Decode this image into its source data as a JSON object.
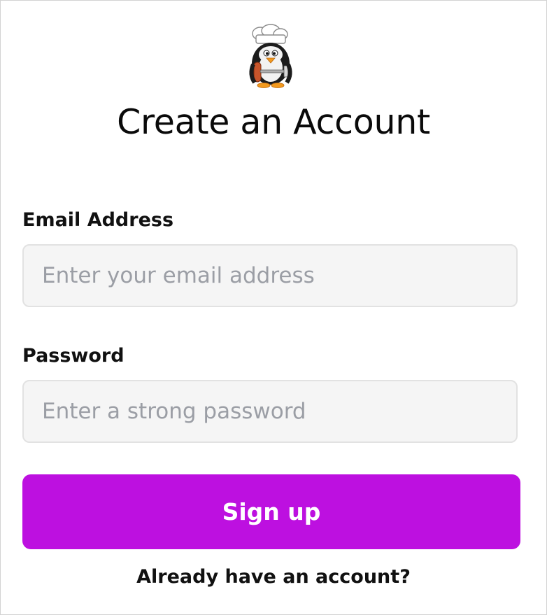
{
  "logo": {
    "icon": "penguin-chef-icon"
  },
  "title": "Create an Account",
  "email": {
    "label": "Email Address",
    "placeholder": "Enter your email address",
    "value": ""
  },
  "password": {
    "label": "Password",
    "placeholder": "Enter a strong password",
    "value": ""
  },
  "signup_button": "Sign up",
  "login_link": "Already have an account?",
  "colors": {
    "accent": "#bd10e0",
    "input_bg": "#f5f5f5",
    "placeholder": "#9b9ea5"
  }
}
